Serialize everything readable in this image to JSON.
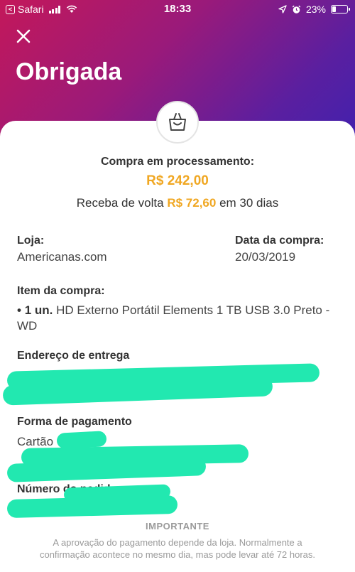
{
  "status_bar": {
    "back_app": "Safari",
    "time": "18:33",
    "battery": "23%",
    "battery_level": 0.23
  },
  "header": {
    "title": "Obrigada"
  },
  "summary": {
    "status_label": "Compra em processamento:",
    "amount": "R$ 242,00",
    "cashback_prefix": "Receba de volta",
    "cashback_amount": "R$ 72,60",
    "cashback_suffix": "em 30 dias"
  },
  "details": {
    "store_label": "Loja:",
    "store_value": "Americanas.com",
    "date_label": "Data da compra:",
    "date_value": "20/03/2019",
    "item_label": "Item da compra:",
    "item_qty": "1 un.",
    "item_name": "HD Externo Portátil Elements 1 TB USB 3.0 Preto - WD",
    "address_label": "Endereço de entrega",
    "payment_label": "Forma de pagamento",
    "payment_value_prefix": "Cartão",
    "order_label": "Número do pedido:"
  },
  "footer": {
    "important_label": "IMPORTANTE",
    "note": "A aprovação do pagamento depende da loja. Normalmente a confirmação acontece no mesmo dia, mas pode levar até 72 horas."
  },
  "colors": {
    "gradient_start": "#c3185a",
    "gradient_end": "#3d21b0",
    "accent": "#f0a722",
    "redaction": "#22e8b0"
  }
}
